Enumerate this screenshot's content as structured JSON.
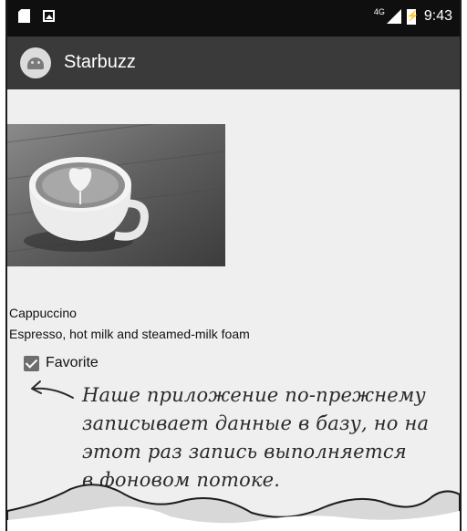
{
  "status_bar": {
    "network": "4G",
    "time": "9:43"
  },
  "app_bar": {
    "title": "Starbuzz"
  },
  "drink": {
    "name": "Cappuccino",
    "description": "Espresso, hot milk and steamed-milk foam",
    "favorite_label": "Favorite",
    "favorite_checked": true
  },
  "annotation": {
    "lines": [
      "Наше приложение по-прежнему",
      "записывает данные в базу, но на",
      "этот раз запись выполняется",
      "в фоновом потоке."
    ]
  },
  "icons": {
    "sd_card": "sd-card-icon",
    "image": "image-notification-icon",
    "signal": "signal-icon",
    "battery": "battery-charging-icon",
    "app": "android-app-icon",
    "arrow": "arrow-annotation-icon",
    "checkbox": "checkbox-checked-icon"
  },
  "colors": {
    "status_bar": "#0f0f0f",
    "app_bar": "#3a3a3a",
    "background": "#efefef"
  }
}
